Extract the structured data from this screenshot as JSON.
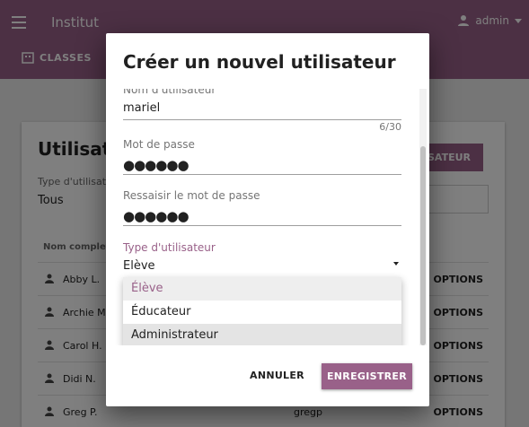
{
  "app": {
    "title": "Institut",
    "user": "admin",
    "tabs": [
      {
        "label": "CLASSES"
      }
    ]
  },
  "page": {
    "title": "Utilisateurs",
    "new_user_button": "NOUVEL UTILISATEUR",
    "filter_label": "Type d'utilisateur",
    "filter_value": "Tous",
    "column_name": "Nom complet",
    "rows": [
      {
        "name": "Abby L.",
        "login": "",
        "options": "OPTIONS"
      },
      {
        "name": "Archie M.",
        "login": "",
        "options": "OPTIONS"
      },
      {
        "name": "Carol H.",
        "login": "",
        "options": "OPTIONS"
      },
      {
        "name": "Didi N.",
        "login": "",
        "options": "OPTIONS"
      },
      {
        "name": "Greg P.",
        "login": "gregp",
        "options": "OPTIONS"
      }
    ]
  },
  "dialog": {
    "title": "Créer un nouvel utilisateur",
    "username": {
      "label": "Nom d'utilisateur",
      "value": "mariel",
      "counter": "6/30"
    },
    "password": {
      "label": "Mot de passe",
      "value": "●●●●●●"
    },
    "password_confirm": {
      "label": "Ressaisir le mot de passe",
      "value": "●●●●●●"
    },
    "user_type": {
      "label": "Type d'utilisateur",
      "value": "Elève"
    },
    "options": [
      {
        "label": "Élève",
        "state": "selected"
      },
      {
        "label": "Éducateur",
        "state": "normal"
      },
      {
        "label": "Administrateur",
        "state": "hover"
      }
    ],
    "cancel_label": "ANNULER",
    "save_label": "ENREGISTRER"
  },
  "colors": {
    "accent": "#996189"
  }
}
